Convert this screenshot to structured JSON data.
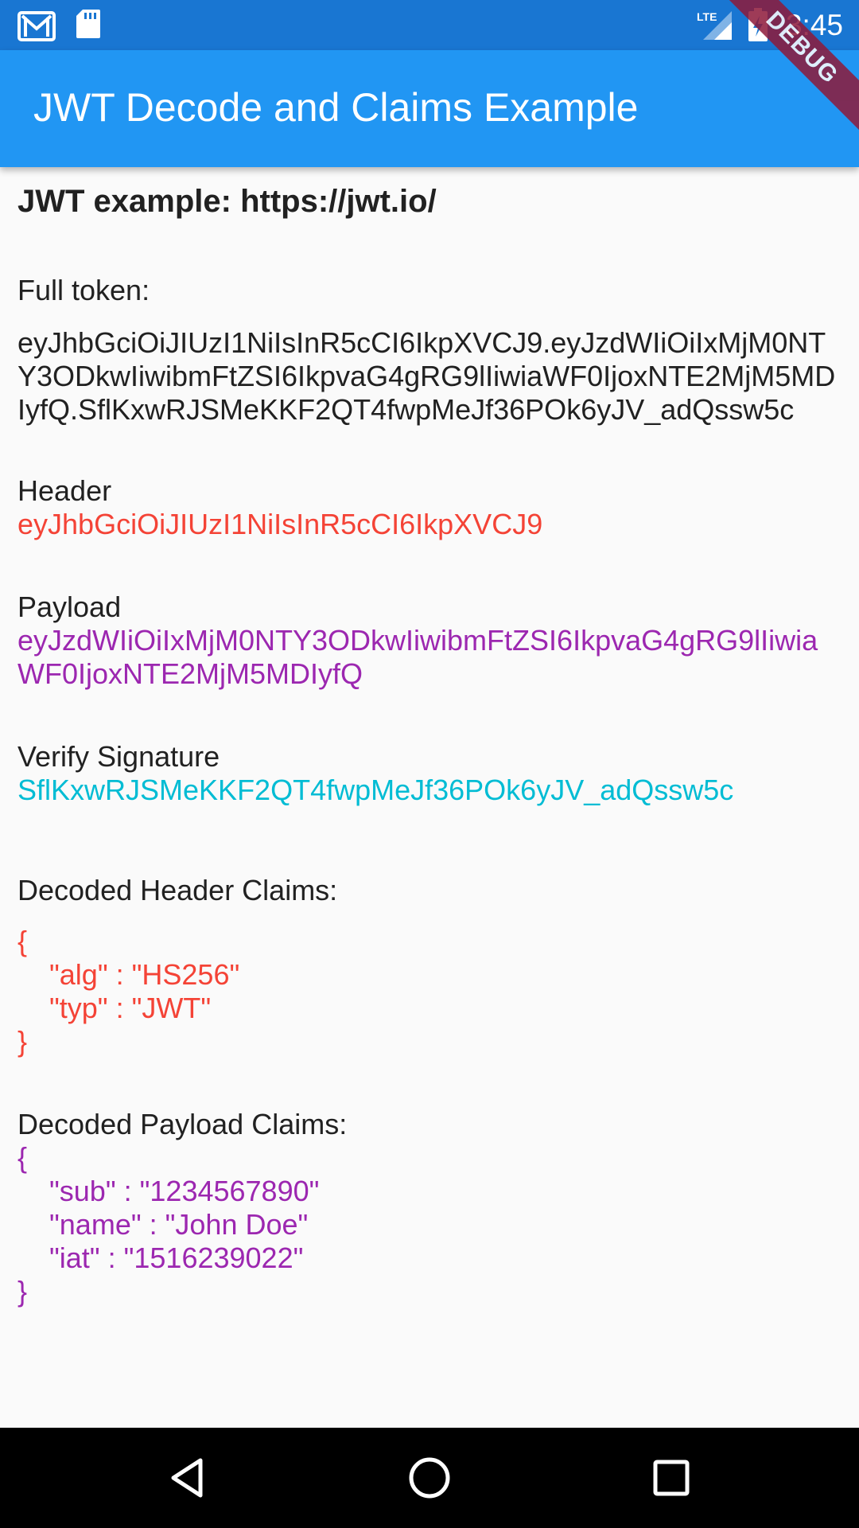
{
  "status_bar": {
    "time": "3:45",
    "network_label": "LTE",
    "icons": [
      "gmail-icon",
      "sd-card-icon",
      "lte-signal-icon",
      "battery-charging-icon"
    ]
  },
  "debug_banner": "DEBUG",
  "app_bar": {
    "title": "JWT Decode and Claims Example"
  },
  "content": {
    "heading": "JWT example: https://jwt.io/",
    "full_token_label": "Full token:",
    "full_token": "eyJhbGciOiJIUzI1NiIsInR5cCI6IkpXVCJ9.eyJzdWIiOiIxMjM0NTY3ODkwIiwibmFtZSI6IkpvaG4gRG9lIiwiaWF0IjoxNTE2MjM5MDIyfQ.SflKxwRJSMeKKF2QT4fwpMeJf36POk6yJV_adQssw5c",
    "header_label": "Header",
    "header_value": "eyJhbGciOiJIUzI1NiIsInR5cCI6IkpXVCJ9",
    "payload_label": "Payload",
    "payload_value": "eyJzdWIiOiIxMjM0NTY3ODkwIiwibmFtZSI6IkpvaG4gRG9lIiwiaWF0IjoxNTE2MjM5MDIyfQ",
    "signature_label": "Verify Signature",
    "signature_value": "SflKxwRJSMeKKF2QT4fwpMeJf36POk6yJV_adQssw5c",
    "decoded_header_label": "Decoded Header Claims:",
    "decoded_header_lines": [
      "{",
      "    \"alg\" : \"HS256\"",
      "    \"typ\" : \"JWT\"",
      "}"
    ],
    "decoded_payload_label": "Decoded Payload Claims:",
    "decoded_payload_lines": [
      "{",
      "    \"sub\" : \"1234567890\"",
      "    \"name\" : \"John Doe\"",
      "    \"iat\" : \"1516239022\"",
      "}"
    ]
  },
  "nav_bar": {
    "buttons": [
      "back-icon",
      "home-icon",
      "recents-icon"
    ]
  },
  "colors": {
    "status_bar": "#1976d2",
    "app_bar": "#2196f3",
    "header_text": "#f44336",
    "payload_text": "#9c27b0",
    "signature_text": "#00bcd4",
    "debug_banner": "#8e1a3a"
  }
}
